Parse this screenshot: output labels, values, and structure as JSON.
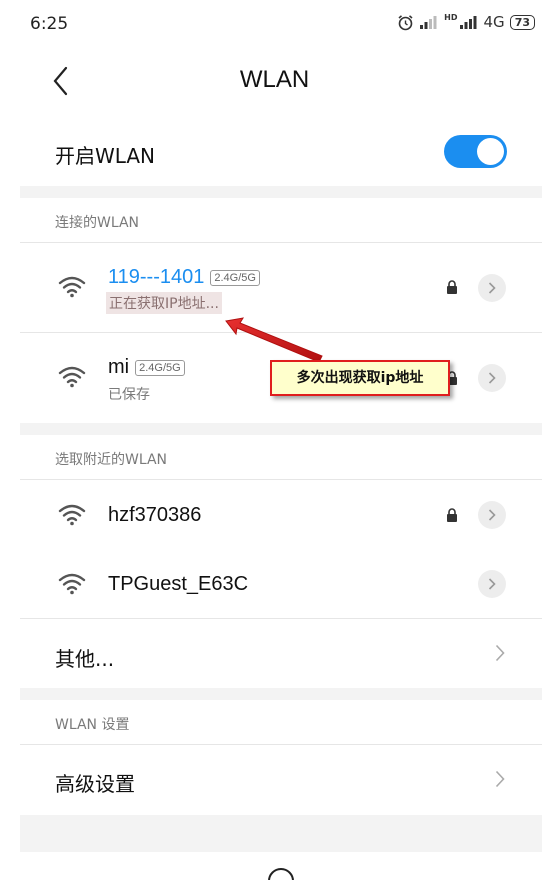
{
  "status_bar": {
    "time": "6:25",
    "network_type": "4G",
    "battery_level": "73",
    "hd_label": "HD"
  },
  "header": {
    "title": "WLAN"
  },
  "wlan_toggle": {
    "label": "开启WLAN",
    "enabled": true
  },
  "connected_section": {
    "header": "连接的WLAN",
    "networks": [
      {
        "name": "119---1401",
        "band": "2.4G/5G",
        "status": "正在获取IP地址...",
        "locked": true,
        "active": true
      },
      {
        "name": "mi",
        "band": "2.4G/5G",
        "status": "已保存",
        "locked": true,
        "active": false
      }
    ]
  },
  "nearby_section": {
    "header": "选取附近的WLAN",
    "networks": [
      {
        "name": "hzf370386",
        "locked": true
      },
      {
        "name": "TPGuest_E63C",
        "locked": false
      }
    ],
    "other_label": "其他..."
  },
  "settings_section": {
    "header": "WLAN 设置",
    "advanced_label": "高级设置"
  },
  "annotation": {
    "text": "多次出现获取ip地址"
  },
  "colors": {
    "accent": "#1b8ef0",
    "callout_border": "#e01e1e",
    "callout_bg": "#ffffcc"
  }
}
